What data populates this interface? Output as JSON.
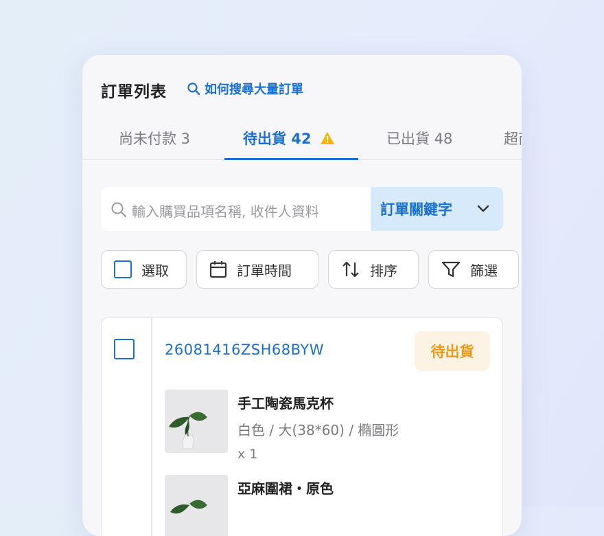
{
  "header": {
    "title": "訂單列表",
    "help_link": "如何搜尋大量訂單"
  },
  "tabs": [
    {
      "label": "尚未付款 3",
      "active": false
    },
    {
      "label": "待出貨 42",
      "active": true,
      "warning": true
    },
    {
      "label": "已出貨 48",
      "active": false
    },
    {
      "label": "超商",
      "active": false
    }
  ],
  "search": {
    "placeholder": "輸入購買品項名稱, 收件人資料",
    "filter_select": "訂單關鍵字"
  },
  "toolbar": {
    "select_label": "選取",
    "order_time_label": "訂單時間",
    "sort_label": "排序",
    "filter_label": "篩選"
  },
  "order": {
    "id": "26081416ZSH68BYW",
    "status": "待出貨",
    "items": [
      {
        "name": "手工陶瓷馬克杯",
        "variant": "白色 / 大(38*60) / 橢圓形",
        "qty": "x 1"
      },
      {
        "name": "亞麻圍裙・原色"
      }
    ]
  },
  "colors": {
    "accent": "#1b6fd1",
    "status_pending": "#e99a19",
    "warning": "#f4b400"
  }
}
